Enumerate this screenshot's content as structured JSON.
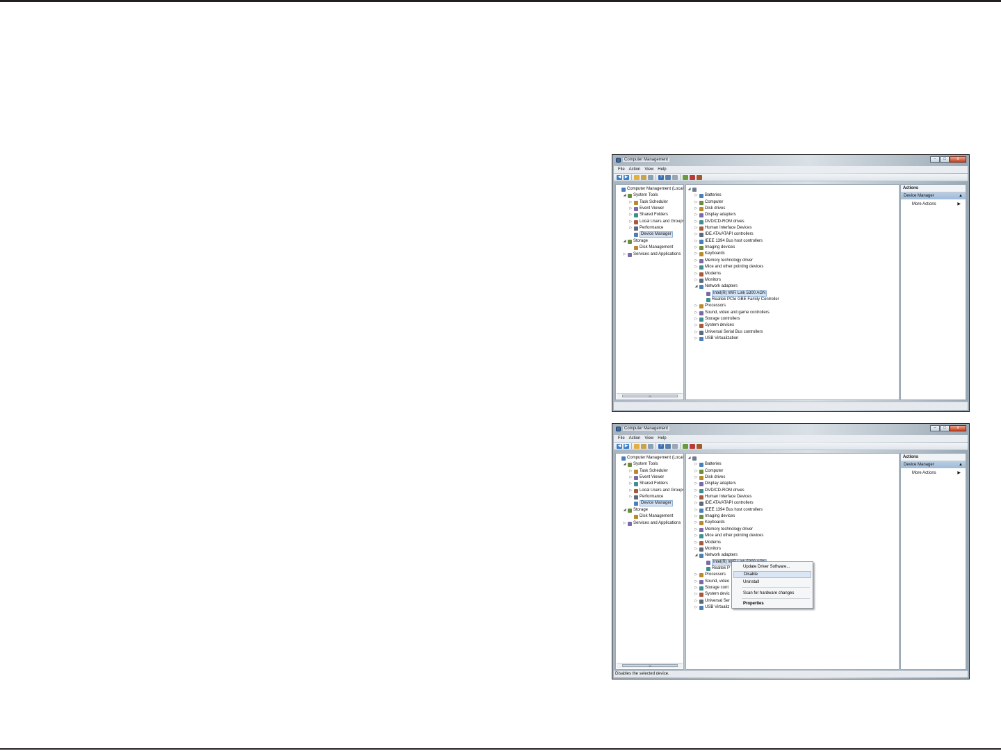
{
  "window": {
    "title": "Computer Management",
    "buttons": [
      "–",
      "□",
      "x"
    ],
    "menu": [
      "File",
      "Action",
      "View",
      "Help"
    ],
    "toolbar_icons": [
      "back-arrow-icon",
      "forward-arrow-icon",
      "up-folder-icon",
      "show-hide-tree-icon",
      "properties-icon",
      "help-icon",
      "view-icon",
      "scan-hardware-icon",
      "update-driver-icon",
      "disable-device-icon",
      "uninstall-device-icon"
    ]
  },
  "left_tree": [
    {
      "label": "Computer Management (Local",
      "icon": "computer-management-icon",
      "indent": 0,
      "expander": ""
    },
    {
      "label": "System Tools",
      "icon": "system-tools-icon",
      "indent": 1,
      "expander": "◢"
    },
    {
      "label": "Task Scheduler",
      "icon": "task-scheduler-icon",
      "indent": 2,
      "expander": "▷"
    },
    {
      "label": "Event Viewer",
      "icon": "event-viewer-icon",
      "indent": 2,
      "expander": "▷"
    },
    {
      "label": "Shared Folders",
      "icon": "shared-folders-icon",
      "indent": 2,
      "expander": "▷"
    },
    {
      "label": "Local Users and Groups",
      "icon": "local-users-icon",
      "indent": 2,
      "expander": "▷"
    },
    {
      "label": "Performance",
      "icon": "performance-icon",
      "indent": 2,
      "expander": "▷"
    },
    {
      "label": "Device Manager",
      "icon": "device-manager-icon",
      "indent": 2,
      "expander": "",
      "selected": true
    },
    {
      "label": "Storage",
      "icon": "storage-icon",
      "indent": 1,
      "expander": "◢"
    },
    {
      "label": "Disk Management",
      "icon": "disk-management-icon",
      "indent": 2,
      "expander": ""
    },
    {
      "label": "Services and Applications",
      "icon": "services-icon",
      "indent": 1,
      "expander": "▷"
    }
  ],
  "scrollbar_grip": "III",
  "device_tree_top": [
    {
      "label": "Batteries",
      "icon": "battery-icon",
      "indent": 1,
      "expander": "▷"
    },
    {
      "label": "Computer",
      "icon": "computer-icon",
      "indent": 1,
      "expander": "▷"
    },
    {
      "label": "Disk drives",
      "icon": "disk-drive-icon",
      "indent": 1,
      "expander": "▷"
    },
    {
      "label": "Display adapters",
      "icon": "display-adapter-icon",
      "indent": 1,
      "expander": "▷"
    },
    {
      "label": "DVD/CD-ROM drives",
      "icon": "dvd-drive-icon",
      "indent": 1,
      "expander": "▷"
    },
    {
      "label": "Human Interface Devices",
      "icon": "hid-icon",
      "indent": 1,
      "expander": "▷"
    },
    {
      "label": "IDE ATA/ATAPI controllers",
      "icon": "ide-controller-icon",
      "indent": 1,
      "expander": "▷"
    },
    {
      "label": "IEEE 1394 Bus host controllers",
      "icon": "ieee1394-icon",
      "indent": 1,
      "expander": "▷"
    },
    {
      "label": "Imaging devices",
      "icon": "imaging-device-icon",
      "indent": 1,
      "expander": "▷"
    },
    {
      "label": "Keyboards",
      "icon": "keyboard-icon",
      "indent": 1,
      "expander": "▷"
    },
    {
      "label": "Memory technology driver",
      "icon": "memory-icon",
      "indent": 1,
      "expander": "▷"
    },
    {
      "label": "Mice and other pointing devices",
      "icon": "mouse-icon",
      "indent": 1,
      "expander": "▷"
    },
    {
      "label": "Modems",
      "icon": "modem-icon",
      "indent": 1,
      "expander": "▷"
    },
    {
      "label": "Monitors",
      "icon": "monitor-icon",
      "indent": 1,
      "expander": "▷"
    },
    {
      "label": "Network adapters",
      "icon": "network-adapter-icon",
      "indent": 1,
      "expander": "◢"
    }
  ],
  "device_tree_bottom": [
    {
      "label": "Processors",
      "icon": "processor-icon",
      "indent": 1,
      "expander": "▷"
    },
    {
      "label": "Sound, video and game controllers",
      "icon": "sound-icon",
      "indent": 1,
      "expander": "▷"
    },
    {
      "label": "Storage controllers",
      "icon": "storage-controller-icon",
      "indent": 1,
      "expander": "▷"
    },
    {
      "label": "System devices",
      "icon": "system-device-icon",
      "indent": 1,
      "expander": "▷"
    },
    {
      "label": "Universal Serial Bus controllers",
      "icon": "usb-icon",
      "indent": 1,
      "expander": "▷"
    },
    {
      "label": "USB Virtualization",
      "icon": "usb-virtualization-icon",
      "indent": 1,
      "expander": "▷"
    }
  ],
  "device_tree_bottom_truncated": [
    {
      "label": "Processors",
      "icon": "processor-icon",
      "indent": 1,
      "expander": "▷"
    },
    {
      "label": "Sound, video",
      "icon": "sound-icon",
      "indent": 1,
      "expander": "▷"
    },
    {
      "label": "Storage cont",
      "icon": "storage-controller-icon",
      "indent": 1,
      "expander": "▷"
    },
    {
      "label": "System devic",
      "icon": "system-device-icon",
      "indent": 1,
      "expander": "▷"
    },
    {
      "label": "Universal Ser",
      "icon": "usb-icon",
      "indent": 1,
      "expander": "▷"
    },
    {
      "label": "USB Virtualiz",
      "icon": "usb-virtualization-icon",
      "indent": 1,
      "expander": "▷"
    }
  ],
  "network_children": [
    {
      "label": "Intel(R) WiFi Link 5300 AGN",
      "icon": "wifi-adapter-icon",
      "selected": true
    },
    {
      "label": "Realtek PCIe GBE Family Controller",
      "icon": "ethernet-adapter-icon"
    }
  ],
  "network_children_truncated": [
    {
      "label": "Intel(R) WiFi Link 5300 AGN",
      "icon": "wifi-adapter-icon",
      "selected": true
    },
    {
      "label": "Realtek P",
      "icon": "ethernet-adapter-icon"
    }
  ],
  "actions": {
    "header": "Actions",
    "section": "Device Manager",
    "more": "More Actions"
  },
  "context_menu": {
    "items": [
      "Update Driver Software...",
      "Disable",
      "Uninstall",
      "Scan for hardware changes",
      "Properties"
    ],
    "highlighted": "Disable"
  },
  "status": {
    "win1": "",
    "win2": "Disables the selected device."
  },
  "colors": {
    "selection": "#d5e3f3",
    "actions_highlight": "#9fbbd9",
    "rule": "#231f20"
  }
}
